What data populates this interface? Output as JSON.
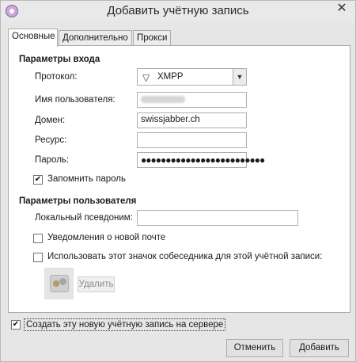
{
  "window": {
    "title": "Добавить учётную запись",
    "close_glyph": "✕",
    "app_icon": "pidgin-icon"
  },
  "tabs": [
    {
      "label": "Основные",
      "active": true
    },
    {
      "label": "Дополнительно",
      "active": false
    },
    {
      "label": "Прокси",
      "active": false
    }
  ],
  "login": {
    "heading": "Параметры входа",
    "protocol_label": "Протокол:",
    "protocol_value": "XMPP",
    "protocol_icon": "xmpp-icon",
    "username_label": "Имя пользователя:",
    "username_value": "",
    "domain_label": "Домен:",
    "domain_value": "swissjabber.ch",
    "resource_label": "Ресурс:",
    "resource_value": "",
    "password_label": "Пароль:",
    "password_value": "●●●●●●●●●●●●●●●●●●●●●●●●●",
    "remember_label": "Запомнить пароль",
    "remember_checked": true
  },
  "user": {
    "heading": "Параметры пользователя",
    "alias_label": "Локальный псевдоним:",
    "alias_value": "",
    "mail_label": "Уведомления о новой почте",
    "mail_checked": false,
    "icon_label": "Использовать этот значок собеседника для этой учётной записи:",
    "icon_checked": false,
    "delete_label": "Удалить"
  },
  "footer": {
    "create_label": "Создать эту новую учётную запись на сервере",
    "create_checked": true,
    "cancel_label": "Отменить",
    "add_label": "Добавить"
  },
  "colors": {
    "window_bg": "#e6e6e6",
    "panel_bg": "#ffffff",
    "border": "#acacac"
  }
}
